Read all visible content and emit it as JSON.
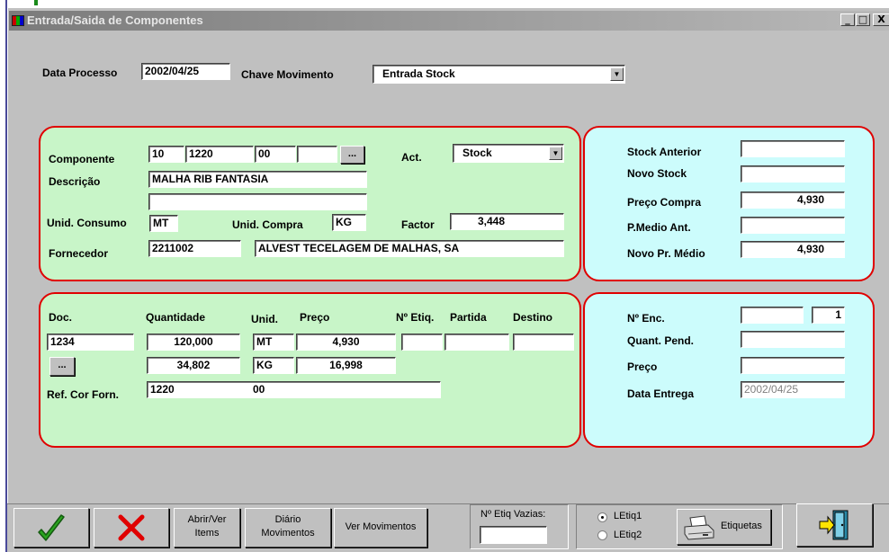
{
  "window": {
    "title": "Entrada/Saida de Componentes"
  },
  "titlebar_buttons": {
    "minimize": "_",
    "restore": "□",
    "close": "X"
  },
  "header": {
    "data_processo_label": "Data Processo",
    "data_processo_value": "2002/04/25",
    "chave_label": "Chave Movimento",
    "chave_value": "Entrada Stock"
  },
  "component_panel": {
    "componente_label": "Componente",
    "comp_code1": "10",
    "comp_code2": "1220",
    "comp_code3": "00",
    "comp_code4": "",
    "browse_label": "...",
    "act_label": "Act.",
    "act_value": "Stock",
    "descricao_label": "Descrição",
    "descricao_value": "MALHA RIB FANTASIA",
    "descricao2_value": "",
    "unid_consumo_label": "Unid. Consumo",
    "unid_consumo_value": "MT",
    "unid_compra_label": "Unid. Compra",
    "unid_compra_value": "KG",
    "factor_label": "Factor",
    "factor_value": "3,448",
    "fornecedor_label": "Fornecedor",
    "fornecedor_code": "2211002",
    "fornecedor_name": "ALVEST TECELAGEM DE MALHAS, SA"
  },
  "stock_panel": {
    "stock_anterior_label": "Stock Anterior",
    "stock_anterior_value": "",
    "novo_stock_label": "Novo Stock",
    "novo_stock_value": "",
    "preco_compra_label": "Preço Compra",
    "preco_compra_value": "4,930",
    "pmedio_label": "P.Medio Ant.",
    "pmedio_value": "",
    "novo_pr_medio_label": "Novo Pr. Médio",
    "novo_pr_medio_value": "4,930"
  },
  "doc_panel": {
    "doc_label": "Doc.",
    "quantidade_label": "Quantidade",
    "unid_label": "Unid.",
    "preco_label": "Preço",
    "netiq_label": "Nº Etiq.",
    "partida_label": "Partida",
    "destino_label": "Destino",
    "doc_value": "1234",
    "qty1": "120,000",
    "unid1": "MT",
    "preco1": "4,930",
    "netiq_value": "",
    "partida_value": "",
    "destino_value": "",
    "browse_label": "...",
    "qty2": "34,802",
    "unid2": "KG",
    "preco2": "16,998",
    "ref_cor_label": "Ref. Cor Forn.",
    "ref_cor_value": "1220",
    "ref_cor_value2": "00"
  },
  "order_panel": {
    "nenc_label": "Nº Enc.",
    "nenc_value": "",
    "nenc_line": "1",
    "quant_pend_label": "Quant. Pend.",
    "quant_pend_value": "",
    "preco_label": "Preço",
    "preco_value": "",
    "data_entrega_label": "Data Entrega",
    "data_entrega_value": "2002/04/25"
  },
  "toolbar": {
    "confirm_icon": "check-icon",
    "cancel_icon": "x-icon",
    "abrir_label_1": "Abrir/Ver",
    "abrir_label_2": "Items",
    "diario_label_1": "Diário",
    "diario_label_2": "Movimentos",
    "ver_mov_label": "Ver Movimentos",
    "etiq_vazias_label": "Nº Etiq Vazias:",
    "etiq_vazias_value": "",
    "letiq1_label": "LEtiq1",
    "letiq2_label": "LEtiq2",
    "etiquetas_label": "Etiquetas",
    "exit_icon": "exit-door-icon"
  },
  "colors": {
    "panel_green": "#c8f5c8",
    "panel_cyan": "#ccfcfc",
    "panel_border": "#e00000",
    "confirm_green": "#2aa51f",
    "cancel_red": "#e00000"
  }
}
